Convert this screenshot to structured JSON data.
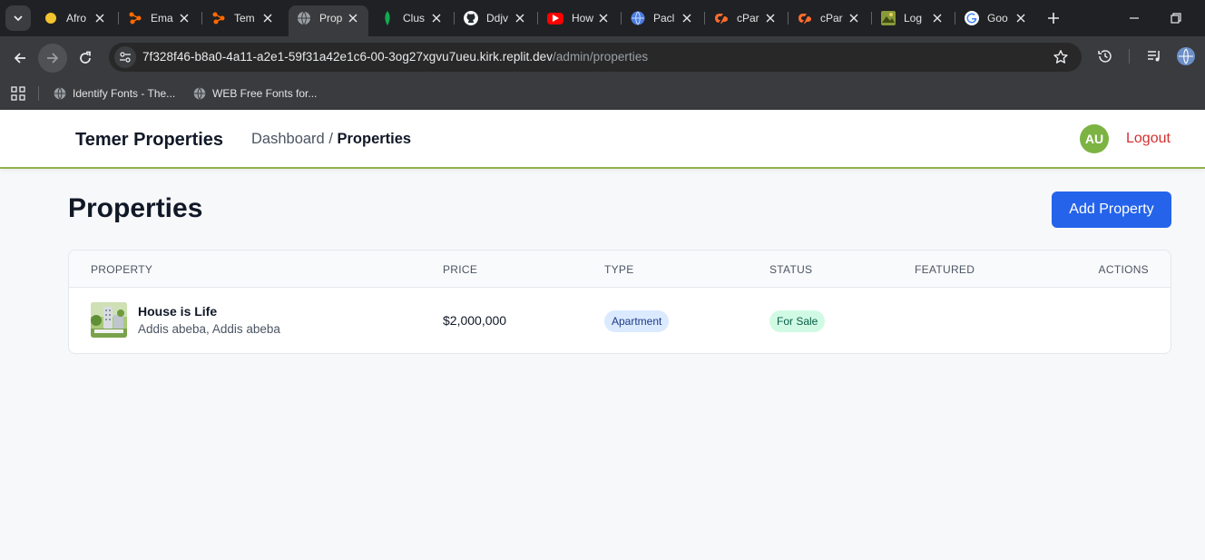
{
  "browser": {
    "tabs": [
      {
        "title": "Afro",
        "icon": "afro-favicon-icon"
      },
      {
        "title": "Ema",
        "icon": "make-favicon-icon"
      },
      {
        "title": "Tem",
        "icon": "make-favicon-icon"
      },
      {
        "title": "Prop",
        "icon": "globe-icon",
        "active": true
      },
      {
        "title": "Clus",
        "icon": "mongodb-leaf-icon"
      },
      {
        "title": "Ddjv",
        "icon": "github-icon"
      },
      {
        "title": "How",
        "icon": "youtube-icon"
      },
      {
        "title": "Pacl",
        "icon": "chrome-web-icon"
      },
      {
        "title": "cPar",
        "icon": "cpanel-icon"
      },
      {
        "title": "cPar",
        "icon": "cpanel-icon"
      },
      {
        "title": "Log",
        "icon": "landscape-icon"
      },
      {
        "title": "Goo",
        "icon": "google-icon"
      }
    ],
    "url_host": "7f328f46-b8a0-4a11-a2e1-59f31a42e1c6-00-3og27xgvu7ueu.kirk.replit.dev",
    "url_path": "/admin/properties",
    "bookmarks": [
      {
        "label": "Identify Fonts - The..."
      },
      {
        "label": "WEB Free Fonts for..."
      }
    ]
  },
  "header": {
    "brand": "Temer Properties",
    "breadcrumb_parent": "Dashboard",
    "breadcrumb_sep": " / ",
    "breadcrumb_current": "Properties",
    "avatar_initials": "AU",
    "logout_label": "Logout"
  },
  "page": {
    "title": "Properties",
    "add_button_label": "Add Property"
  },
  "table": {
    "columns": [
      "PROPERTY",
      "PRICE",
      "TYPE",
      "STATUS",
      "FEATURED",
      "ACTIONS"
    ],
    "rows": [
      {
        "name": "House is Life",
        "location": "Addis abeba, Addis abeba",
        "price": "$2,000,000",
        "type": "Apartment",
        "status": "For Sale",
        "featured": "",
        "actions": ""
      }
    ]
  },
  "colors": {
    "primary": "#2563eb",
    "accent_line": "#8fb24a",
    "avatar_bg": "#7cb342",
    "logout": "#d32f2f"
  }
}
